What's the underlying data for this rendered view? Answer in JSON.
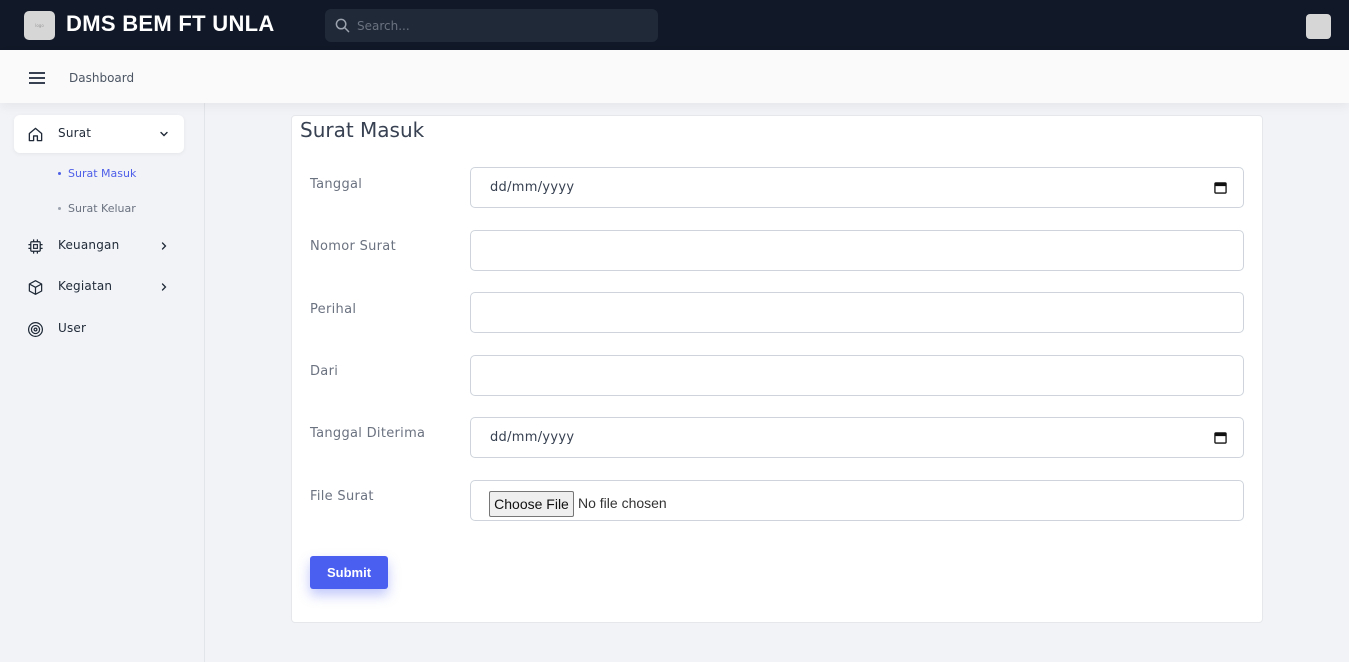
{
  "app": {
    "title": "DMS BEM FT UNLA",
    "logo_text": "logo"
  },
  "search": {
    "placeholder": "Search..."
  },
  "header": {
    "breadcrumb": "Dashboard"
  },
  "sidebar": {
    "items": [
      {
        "label": "Surat",
        "icon": "home-icon",
        "expanded": true,
        "children": [
          {
            "label": "Surat Masuk",
            "active": true
          },
          {
            "label": "Surat Keluar",
            "active": false
          }
        ]
      },
      {
        "label": "Keuangan",
        "icon": "cpu-icon",
        "expanded": false
      },
      {
        "label": "Kegiatan",
        "icon": "box-icon",
        "expanded": false
      },
      {
        "label": "User",
        "icon": "target-icon"
      }
    ]
  },
  "form": {
    "title": "Surat Masuk",
    "fields": [
      {
        "label": "Tanggal",
        "type": "date",
        "value": "dd/mm/yyyy"
      },
      {
        "label": "Nomor Surat",
        "type": "text",
        "value": ""
      },
      {
        "label": "Perihal",
        "type": "text",
        "value": ""
      },
      {
        "label": "Dari",
        "type": "text",
        "value": ""
      },
      {
        "label": "Tanggal Diterima",
        "type": "date",
        "value": "dd/mm/yyyy"
      },
      {
        "label": "File Surat",
        "type": "file",
        "button": "Choose File",
        "status": "No file chosen"
      }
    ],
    "submit_label": "Submit"
  },
  "colors": {
    "topbar": "#111827",
    "accent": "#4a5ef0",
    "background": "#f1f3f7"
  }
}
